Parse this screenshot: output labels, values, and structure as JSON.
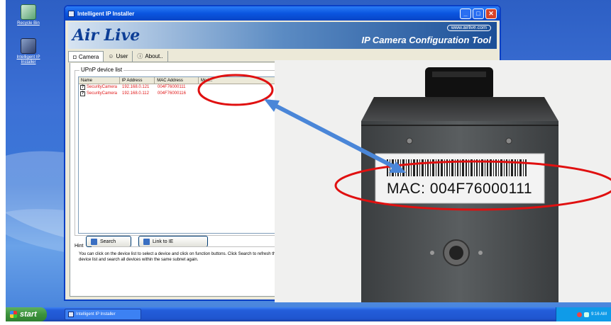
{
  "desktop": {
    "icons": [
      {
        "label": "Recycle Bin",
        "icon": "recycle-bin-icon"
      },
      {
        "label": "Intelligent IP Installer",
        "icon": "installer-icon"
      }
    ]
  },
  "window": {
    "title": "Intelligent IP Installer",
    "banner": {
      "logo": "Air Live",
      "url": "www.airlive.com",
      "tool_title": "IP Camera Configuration Tool"
    },
    "tabs": [
      {
        "label": "Camera",
        "icon": "camera-icon"
      },
      {
        "label": "User",
        "icon": "user-icon"
      },
      {
        "label": "About..",
        "icon": "info-icon"
      }
    ],
    "device_list": {
      "group_label": "UPnP device list",
      "columns": [
        "Name",
        "IP Address",
        "MAC Address",
        "Mod..."
      ],
      "rows": [
        {
          "name": "SecurityCamera",
          "ip": "192.168.0.121",
          "mac": "004F76000111"
        },
        {
          "name": "SecurityCamera",
          "ip": "192.168.0.112",
          "mac": "004F76000116"
        }
      ]
    },
    "buttons": {
      "search": "Search",
      "link": "Link to IE"
    },
    "hint": {
      "label": "Hint",
      "text": "You can click on the device list to select a device and click on function buttons. Click Search to refresh the device list and search all devices  within the same subnet again."
    }
  },
  "photo": {
    "mac_label": "MAC: 004F76000111"
  },
  "taskbar": {
    "start": "start",
    "task": "Intelligent IP Installer",
    "clock": "9:16 AM"
  },
  "colors": {
    "annotation_red": "#e01010",
    "arrow_blue": "#4a86d8",
    "title_blue": "#0a55df",
    "list_text_red": "#e01818"
  }
}
